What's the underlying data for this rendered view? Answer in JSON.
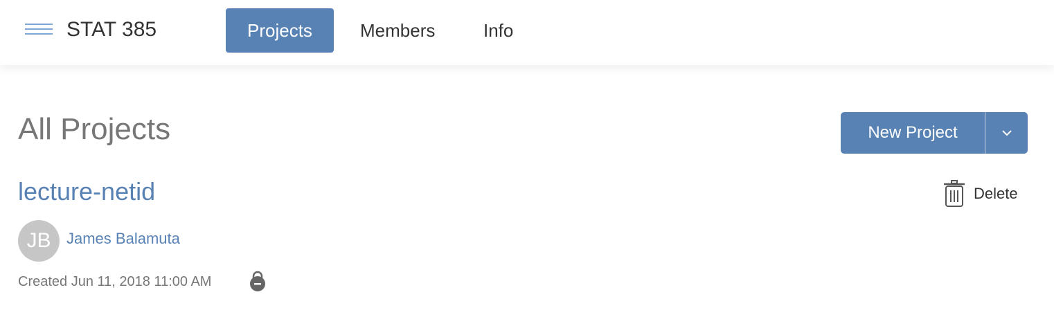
{
  "header": {
    "menu_icon": "hamburger-icon",
    "title": "STAT 385",
    "tabs": [
      {
        "label": "Projects",
        "active": true
      },
      {
        "label": "Members"
      },
      {
        "label": "Info"
      }
    ]
  },
  "main": {
    "heading": "All Projects",
    "new_project_label": "New Project",
    "dropdown_icon": "chevron-down-icon",
    "project": {
      "name": "lecture-netid",
      "delete_label": "Delete",
      "owner_initials": "JB",
      "owner_name": "James Balamuta",
      "created": "Created Jun 11, 2018 11:00 AM",
      "lock_icon": "lock-icon"
    }
  },
  "colors": {
    "accent": "#5882b4",
    "avatar": "#c6c6c6"
  }
}
